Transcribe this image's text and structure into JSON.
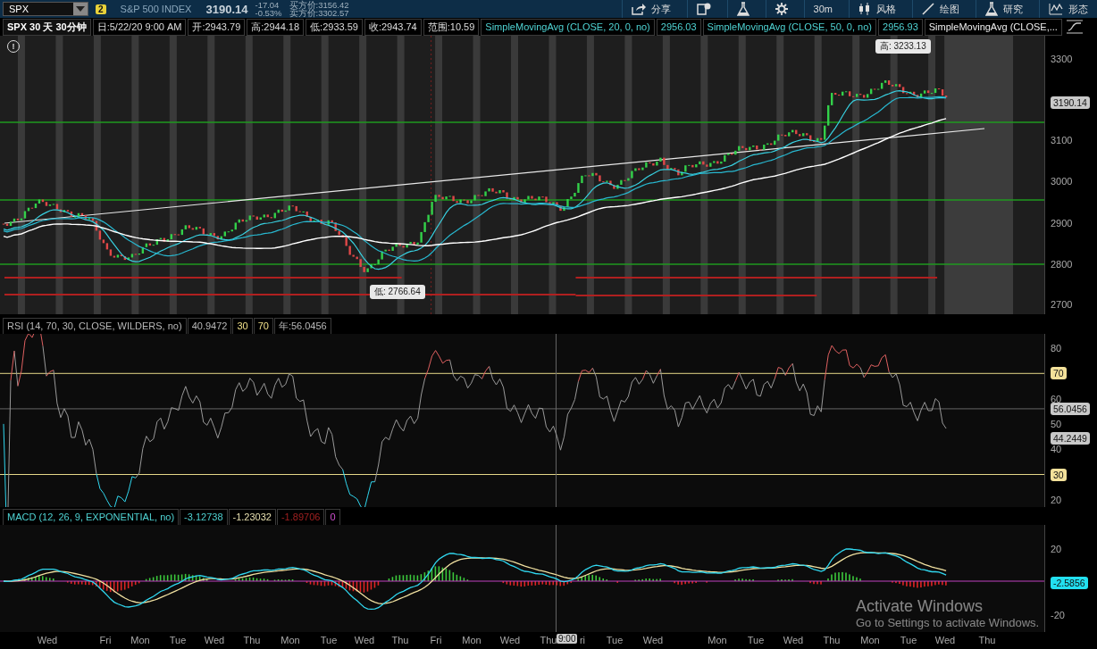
{
  "toolbar": {
    "symbol": "SPX",
    "link_badge": "2",
    "name": "S&P 500 INDEX",
    "price": "3190.14",
    "change": "-17.04",
    "change_pct": "-0.53%",
    "bid": "买方价:3156.42",
    "ask": "卖方价:3302.57",
    "buttons": [
      {
        "kind": "share",
        "label": "分享"
      },
      {
        "kind": "note"
      },
      {
        "kind": "flask"
      },
      {
        "kind": "gear"
      },
      {
        "kind": "text",
        "label": "30m"
      },
      {
        "kind": "style",
        "label": "风格"
      },
      {
        "kind": "draw",
        "label": "绘图"
      },
      {
        "kind": "flask",
        "label": "研究"
      },
      {
        "kind": "pattern",
        "label": "形态"
      }
    ]
  },
  "price_header": [
    {
      "text": "SPX 30 天 30分钟",
      "kind": "title"
    },
    {
      "text": "日:5/22/20 9:00 AM",
      "kind": "field"
    },
    {
      "text": "开:2943.79",
      "kind": "field"
    },
    {
      "text": "高:2944.18",
      "kind": "field"
    },
    {
      "text": "低:2933.59",
      "kind": "field"
    },
    {
      "text": "收:2943.74",
      "kind": "field"
    },
    {
      "text": "范围:10.59",
      "kind": "field"
    },
    {
      "text": "SimpleMovingAvg (CLOSE, 20, 0, no)",
      "kind": "cyan"
    },
    {
      "text": "2956.03",
      "kind": "cyan"
    },
    {
      "text": "SimpleMovingAvg (CLOSE, 50, 0, no)",
      "kind": "cyan"
    },
    {
      "text": "2956.93",
      "kind": "cyan"
    },
    {
      "text": "SimpleMovingAvg (CLOSE,...",
      "kind": "white"
    }
  ],
  "price_chart": {
    "alert_icon": "!",
    "y_labels": [
      "3300",
      "3100",
      "3000",
      "2900",
      "2800",
      "2700"
    ],
    "last_price": {
      "text": "3190.14",
      "color": "#c8c8c8"
    },
    "high_note": "高: 3233.13",
    "low_note": "低: 2766.64"
  },
  "rsi": {
    "header": [
      {
        "text": "RSI (14, 70, 30, CLOSE, WILDERS, no)",
        "kind": "grey"
      },
      {
        "text": "40.9472",
        "kind": "grey"
      },
      {
        "text": "30",
        "kind": "yellow"
      },
      {
        "text": "70",
        "kind": "yellow"
      },
      {
        "text": "年:56.0456",
        "kind": "grey"
      }
    ],
    "y_labels": [
      "80",
      "60",
      "50",
      "40",
      "20"
    ],
    "badges": [
      {
        "text": "70",
        "color": "#f3e19a"
      },
      {
        "text": "56.0456",
        "color": "#c8c8c8"
      },
      {
        "text": "44.2449",
        "color": "#c8c8c8"
      },
      {
        "text": "30",
        "color": "#f3e19a"
      }
    ]
  },
  "macd": {
    "header": [
      {
        "text": "MACD (12, 26, 9, EXPONENTIAL, no)",
        "kind": "cyan"
      },
      {
        "text": "-3.12738",
        "kind": "cyan"
      },
      {
        "text": "-1.23032",
        "kind": "cream"
      },
      {
        "text": "-1.89706",
        "kind": "darkred"
      },
      {
        "text": "0",
        "kind": "magenta"
      }
    ],
    "y_labels": [
      "20",
      "-20"
    ],
    "badge": {
      "text": "-2.5856",
      "color": "#22e0f0"
    }
  },
  "x_axis": {
    "labels": [
      "Wed",
      "Fri",
      "Mon",
      "Tue",
      "Wed",
      "Thu",
      "Mon",
      "Tue",
      "Wed",
      "Thu",
      "Fri",
      "Mon",
      "Wed",
      "Thu",
      "ri",
      "Tue",
      "Wed",
      "Mon",
      "Tue",
      "Wed",
      "Thu",
      "Mon",
      "Tue",
      "Wed",
      "Thu"
    ],
    "cursor_time": "9:00"
  },
  "watermark": {
    "title": "Activate Windows",
    "hint": "Go to Settings to activate Windows."
  }
}
